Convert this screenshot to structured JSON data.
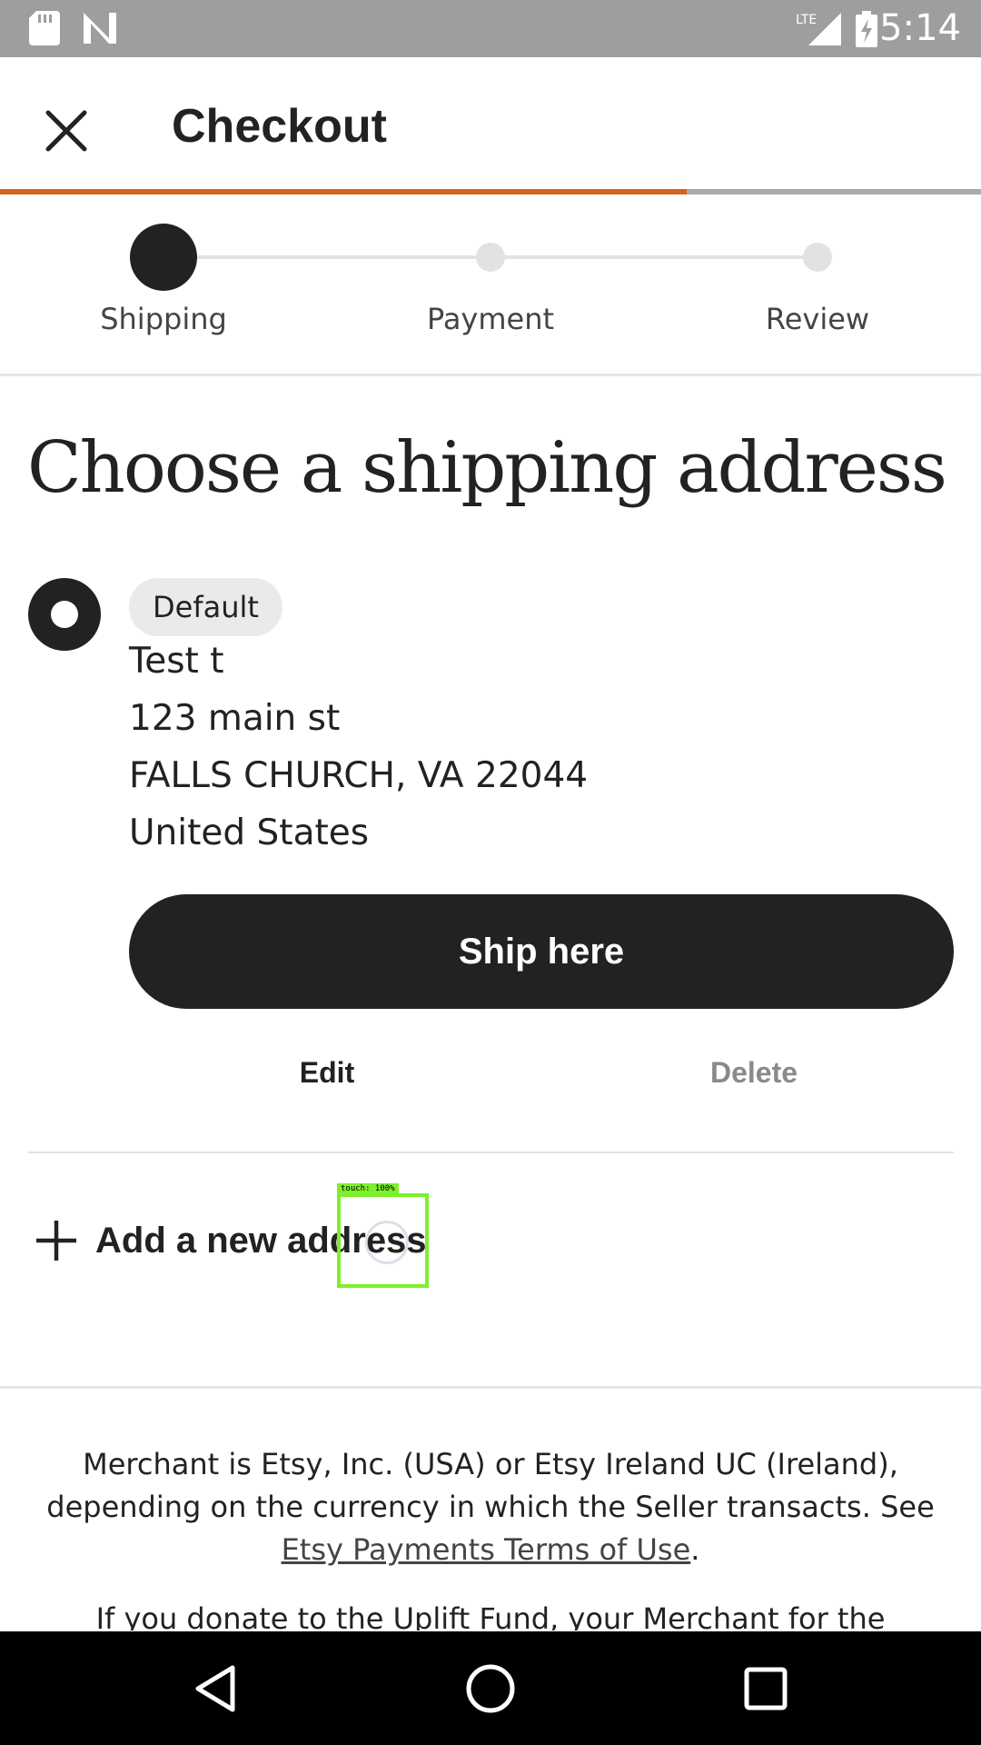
{
  "status_bar": {
    "time": "5:14",
    "network": "LTE",
    "left_icons": [
      "sd-card-icon",
      "n-notification-icon"
    ],
    "right_icons": [
      "signal-icon",
      "battery-charging-icon"
    ]
  },
  "app_bar": {
    "title": "Checkout",
    "close_icon": "close-icon",
    "progress_percent": 70,
    "progress_color": "#d5641c"
  },
  "stepper": {
    "steps": [
      {
        "label": "Shipping",
        "active": true
      },
      {
        "label": "Payment",
        "active": false
      },
      {
        "label": "Review",
        "active": false
      }
    ]
  },
  "main": {
    "heading": "Choose a shipping address",
    "address": {
      "badge": "Default",
      "name": "Test t",
      "street": "123 main st",
      "city_line": "FALLS CHURCH, VA 22044",
      "country": "United States",
      "selected": true
    },
    "ship_button": "Ship here",
    "edit_label": "Edit",
    "delete_label": "Delete",
    "add_address_label": "Add a new address"
  },
  "touch_overlay": {
    "label": "touch: 100%"
  },
  "footer": {
    "line1": "Merchant is Etsy, Inc. (USA) or Etsy Ireland UC (Ireland),",
    "line2": "depending on the currency in which the Seller transacts. See",
    "link": "Etsy Payments Terms of Use",
    "link_suffix": ".",
    "cut_off_line": "If you donate to the Uplift Fund, your Merchant for the"
  },
  "nav_bar": {
    "buttons": [
      "back-icon",
      "home-icon",
      "recents-icon"
    ]
  }
}
